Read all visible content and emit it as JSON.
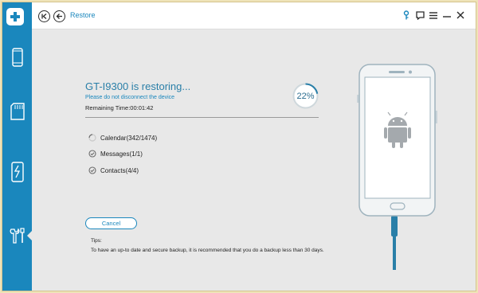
{
  "app": {
    "logo": "plus-logo",
    "sidebar": [
      {
        "id": "phone",
        "icon": "phone-icon",
        "active": false
      },
      {
        "id": "sdcard",
        "icon": "sd-card-icon",
        "active": false
      },
      {
        "id": "transfer",
        "icon": "phone-transfer-icon",
        "active": false
      },
      {
        "id": "tools",
        "icon": "tools-icon",
        "active": true
      }
    ]
  },
  "topbar": {
    "breadcrumb": "Restore",
    "icons": [
      "first-page-icon",
      "back-icon",
      "key-icon",
      "feedback-icon",
      "menu-icon",
      "minimize-icon",
      "close-icon"
    ]
  },
  "restore": {
    "title": "GT-I9300 is restoring...",
    "warning": "Please do not disconnect the device",
    "remaining_label": "Remaining Time:",
    "remaining_value": "00:01:42",
    "percent_text": "22%",
    "percent_value": 0.22,
    "items": [
      {
        "label": "Calendar(342/1474)",
        "status": "in-progress"
      },
      {
        "label": "Messages(1/1)",
        "status": "done"
      },
      {
        "label": "Contacts(4/4)",
        "status": "done"
      }
    ],
    "cancel_label": "Cancel",
    "tips_title": "Tips:",
    "tips_body": "To have an up-to date and secure backup, it is recommended that you do a backup less than 30 days."
  },
  "colors": {
    "accent": "#1a87bd",
    "sidebar": "#1a87bd",
    "background": "#e8e8e8",
    "android": "#a4a9ad"
  }
}
